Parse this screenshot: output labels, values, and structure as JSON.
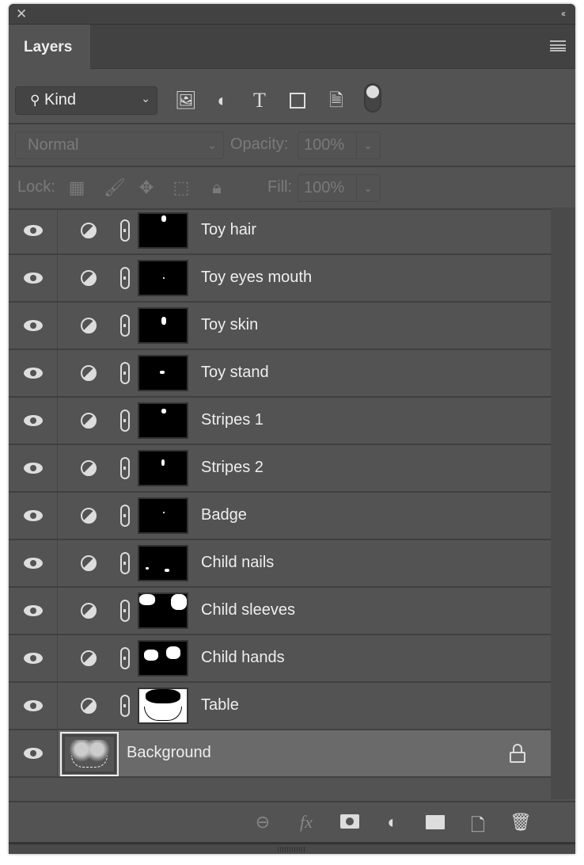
{
  "panel": {
    "tab": "Layers",
    "close": "✕",
    "collapse": "‹‹"
  },
  "filter": {
    "kind": "Kind",
    "icons": [
      "image-filter-icon",
      "adjustment-filter-icon",
      "type-filter-icon",
      "shape-filter-icon",
      "smart-object-filter-icon",
      "filter-toggle"
    ]
  },
  "blend": {
    "mode": "Normal",
    "opacity_label": "Opacity:",
    "opacity": "100%"
  },
  "lock": {
    "label": "Lock:",
    "fill_label": "Fill:",
    "fill": "100%"
  },
  "layers": [
    {
      "name": "Toy hair"
    },
    {
      "name": "Toy eyes mouth"
    },
    {
      "name": "Toy skin"
    },
    {
      "name": "Toy stand"
    },
    {
      "name": "Stripes 1"
    },
    {
      "name": "Stripes 2"
    },
    {
      "name": "Badge"
    },
    {
      "name": "Child nails"
    },
    {
      "name": "Child sleeves"
    },
    {
      "name": "Child hands"
    },
    {
      "name": "Table"
    },
    {
      "name": "Background",
      "selected": true,
      "locked": true
    }
  ],
  "footer": {
    "icons": [
      "link-layers-icon",
      "fx-icon",
      "add-mask-icon",
      "new-adjustment-icon",
      "new-group-icon",
      "new-layer-icon",
      "delete-icon"
    ],
    "fx": "fx"
  }
}
